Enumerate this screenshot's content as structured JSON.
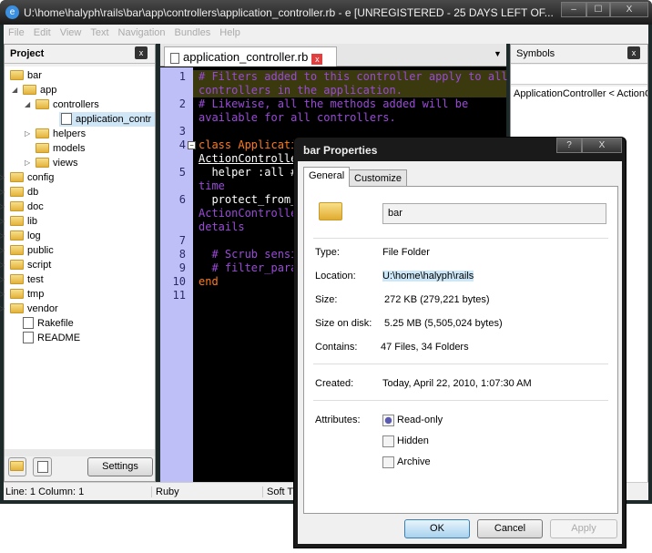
{
  "window": {
    "title": "U:\\home\\halyph\\rails\\bar\\app\\controllers\\application_controller.rb - e  [UNREGISTERED - 25 DAYS LEFT OF...",
    "minimize": "‒",
    "maximize": "☐",
    "close": "X"
  },
  "menu": [
    "File",
    "Edit",
    "View",
    "Text",
    "Navigation",
    "Bundles",
    "Help"
  ],
  "project": {
    "title": "Project",
    "close": "x",
    "tree": [
      {
        "label": "bar",
        "type": "folder"
      },
      {
        "label": "app",
        "type": "folder"
      },
      {
        "label": "controllers",
        "type": "folder"
      },
      {
        "label": "application_contr",
        "type": "file",
        "selected": true
      },
      {
        "label": "helpers",
        "type": "folder"
      },
      {
        "label": "models",
        "type": "folder"
      },
      {
        "label": "views",
        "type": "folder"
      },
      {
        "label": "config",
        "type": "folder"
      },
      {
        "label": "db",
        "type": "folder"
      },
      {
        "label": "doc",
        "type": "folder"
      },
      {
        "label": "lib",
        "type": "folder"
      },
      {
        "label": "log",
        "type": "folder"
      },
      {
        "label": "public",
        "type": "folder"
      },
      {
        "label": "script",
        "type": "folder"
      },
      {
        "label": "test",
        "type": "folder"
      },
      {
        "label": "tmp",
        "type": "folder"
      },
      {
        "label": "vendor",
        "type": "folder"
      },
      {
        "label": "Rakefile",
        "type": "file"
      },
      {
        "label": "README",
        "type": "file"
      }
    ],
    "settings": "Settings"
  },
  "editor": {
    "tab": "application_controller.rb",
    "tab_close": "x",
    "line_numbers": [
      "1",
      "2",
      "3",
      "4",
      "5",
      "6",
      "7",
      "8",
      "9",
      "10",
      "11"
    ],
    "lines": [
      {
        "t": "# Filters added to this controller apply to all",
        "c": "cm"
      },
      {
        "t": "controllers in the application.",
        "c": "cm"
      },
      {
        "t": "# Likewise, all the methods added will be",
        "c": "cm"
      },
      {
        "t": "available for all controllers.",
        "c": "cm"
      },
      {
        "t": "",
        "c": "pl"
      },
      {
        "t": "class Applicati",
        "c": "kw"
      },
      {
        "t": "ActionControlle",
        "c": "pl"
      },
      {
        "t": "  helper :all #",
        "c": "pl"
      },
      {
        "t": "time",
        "c": "cm"
      },
      {
        "t": "  protect_from_",
        "c": "pl"
      },
      {
        "t": "ActionControlle",
        "c": "cm"
      },
      {
        "t": "details",
        "c": "cm"
      },
      {
        "t": "",
        "c": "pl"
      },
      {
        "t": "  # Scrub sensi",
        "c": "cm"
      },
      {
        "t": "  # filter_para",
        "c": "cm"
      },
      {
        "t": "end",
        "c": "kw"
      }
    ]
  },
  "symbols": {
    "title": "Symbols",
    "close": "x",
    "items": [
      "ApplicationController < ActionC"
    ]
  },
  "status": {
    "position": "Line: 1  Column: 1",
    "language": "Ruby",
    "tabs": "Soft T"
  },
  "dialog": {
    "title": "bar Properties",
    "help": "?",
    "close": "X",
    "tabs": [
      "General",
      "Customize"
    ],
    "name": "bar",
    "fields": [
      {
        "label": "Type:",
        "value": "File Folder"
      },
      {
        "label": "Location:",
        "value": "U:\\home\\halyph\\rails"
      },
      {
        "label": "Size:",
        "value": "272 KB (279,221 bytes)"
      },
      {
        "label": "Size on disk:",
        "value": "5.25 MB (5,505,024 bytes)"
      },
      {
        "label": "Contains:",
        "value": "47 Files, 34 Folders"
      },
      {
        "label": "Created:",
        "value": "Today, April 22, 2010, 1:07:30 AM"
      }
    ],
    "attributes_label": "Attributes:",
    "attributes": [
      {
        "label": "Read-only",
        "checked": "indeterminate"
      },
      {
        "label": "Hidden",
        "checked": false
      },
      {
        "label": "Archive",
        "checked": false
      }
    ],
    "ok": "OK",
    "cancel": "Cancel",
    "apply": "Apply"
  }
}
